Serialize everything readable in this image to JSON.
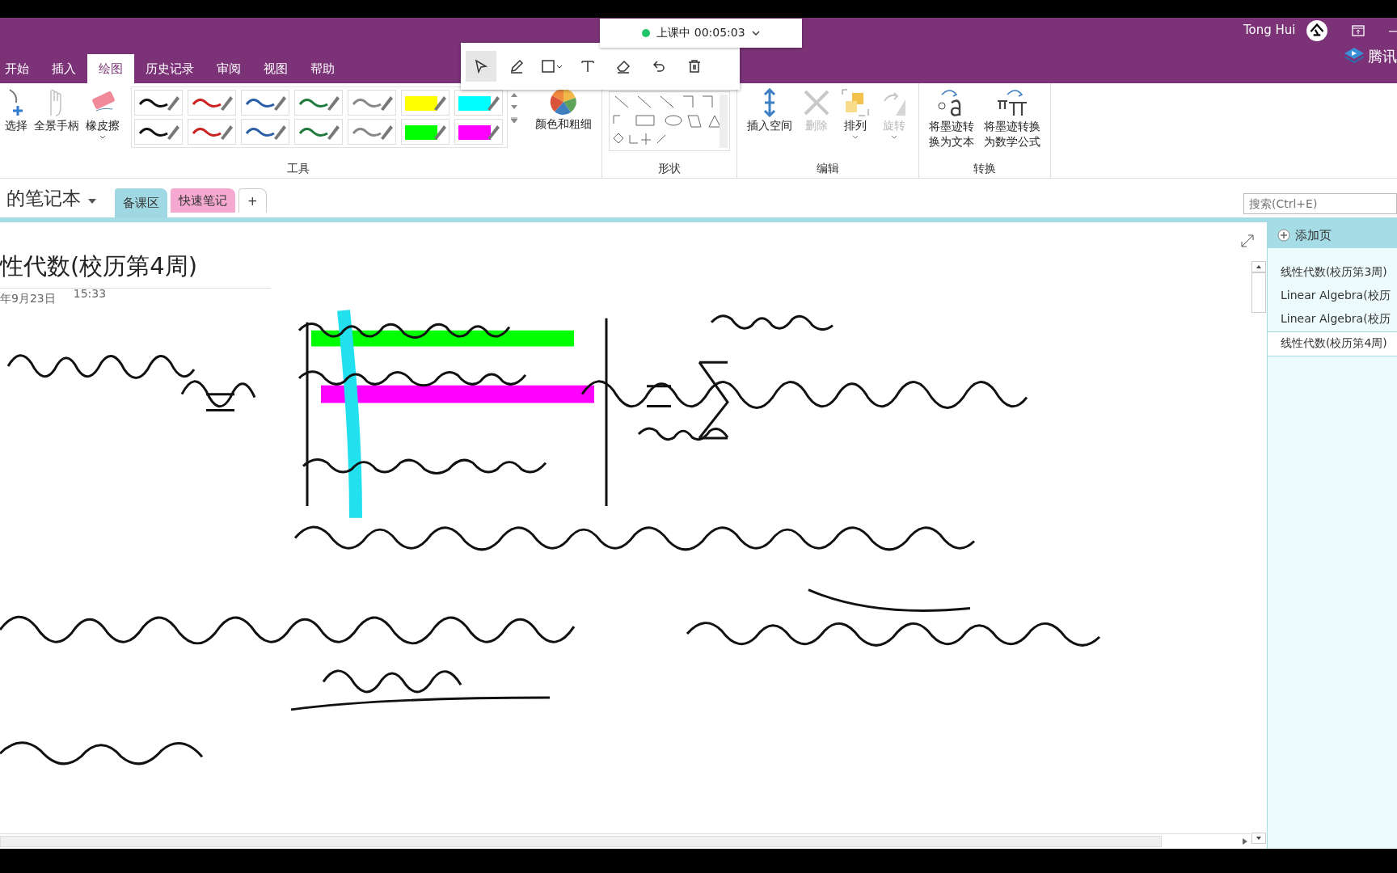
{
  "meeting_bar": {
    "status": "上课中 00:05:03",
    "live": true
  },
  "pen_toolbar": {
    "tools": [
      {
        "kind": "select",
        "selected": true
      },
      {
        "kind": "pen",
        "selected": false
      },
      {
        "kind": "shape",
        "selected": false
      },
      {
        "kind": "text",
        "selected": false
      },
      {
        "kind": "eraser",
        "selected": false
      },
      {
        "kind": "undo",
        "selected": false
      },
      {
        "kind": "delete",
        "selected": false
      }
    ]
  },
  "title_bar": {
    "user": "Tong Hui",
    "brand": "腾讯"
  },
  "ribbon_tabs": [
    {
      "label": "开始",
      "selected": false
    },
    {
      "label": "插入",
      "selected": false
    },
    {
      "label": "绘图",
      "selected": true
    },
    {
      "label": "历史记录",
      "selected": false
    },
    {
      "label": "审阅",
      "selected": false
    },
    {
      "label": "视图",
      "selected": false
    },
    {
      "label": "帮助",
      "selected": false
    }
  ],
  "tools_group": {
    "label": "工具",
    "buttons": [
      "选择",
      "全景手柄",
      "橡皮擦"
    ],
    "pens": [
      {
        "kind": "pen",
        "color": "#111111"
      },
      {
        "kind": "pen",
        "color": "#cc2222"
      },
      {
        "kind": "pen",
        "color": "#2a5fa8"
      },
      {
        "kind": "pen",
        "color": "#1f7a3c"
      },
      {
        "kind": "pen",
        "color": "#888888"
      },
      {
        "kind": "highlighter",
        "color": "#ffff00"
      },
      {
        "kind": "highlighter",
        "color": "#00ffff"
      },
      {
        "kind": "pen",
        "color": "#111111"
      },
      {
        "kind": "pen",
        "color": "#cc2222"
      },
      {
        "kind": "pen",
        "color": "#2a5fa8"
      },
      {
        "kind": "pen",
        "color": "#1f7a3c"
      },
      {
        "kind": "pen",
        "color": "#888888"
      },
      {
        "kind": "highlighter",
        "color": "#00ff00"
      },
      {
        "kind": "highlighter",
        "color": "#ff00ff"
      }
    ],
    "color_button": "颜色和粗细"
  },
  "shapes_group": {
    "label": "形状"
  },
  "edit_group": {
    "label": "编辑",
    "buttons": [
      {
        "label": "插入空间",
        "kind": "space",
        "disabled": false
      },
      {
        "label": "删除",
        "kind": "delete",
        "disabled": true
      },
      {
        "label": "排列",
        "kind": "arrange",
        "disabled": false
      },
      {
        "label": "旋转",
        "kind": "rotate",
        "disabled": true
      }
    ]
  },
  "convert_group": {
    "label": "转换",
    "buttons": [
      {
        "lines": [
          "将墨迹转",
          "换为文本"
        ],
        "kind": "text"
      },
      {
        "lines": [
          "将墨迹转换",
          "为数学公式"
        ],
        "kind": "math"
      }
    ]
  },
  "notebook": {
    "name": "的笔记本",
    "sections": [
      {
        "label": "备课区",
        "color": "#9fd8e3",
        "selected": true
      },
      {
        "label": "快速笔记",
        "color": "#f5a9d0",
        "selected": false
      }
    ],
    "add": "+"
  },
  "search": {
    "placeholder": "搜索(Ctrl+E)"
  },
  "page": {
    "title": "性代数(校历第4周)",
    "date": "年9月23日",
    "time": "15:33"
  },
  "pages_pane": {
    "add_page": "添加页",
    "pages": [
      {
        "title": "线性代数(校历第3周)",
        "selected": false
      },
      {
        "title": "Linear Algebra(校历",
        "selected": false
      },
      {
        "title": "Linear Algebra(校历",
        "selected": false
      },
      {
        "title": "线性代数(校历第4周)",
        "selected": true
      }
    ]
  }
}
